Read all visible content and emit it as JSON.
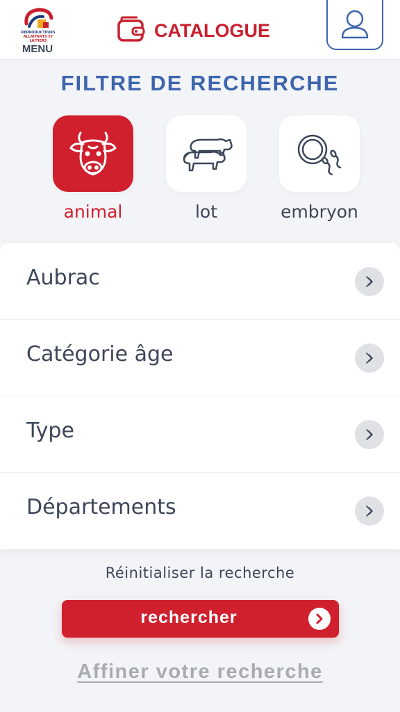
{
  "header": {
    "logo_text_line1": "REPRODUCTEURS",
    "logo_text_line2": "ALLAITANTS ET LAITIERS",
    "menu_label": "MENU",
    "title": "CATALOGUE",
    "title_icon": "wallet-icon",
    "account_icon": "user-icon"
  },
  "filter_title": "FILTRE DE RECHERCHE",
  "categories": [
    {
      "label": "animal",
      "icon": "cow-head-icon",
      "active": true
    },
    {
      "label": "lot",
      "icon": "herd-icon",
      "active": false
    },
    {
      "label": "embryon",
      "icon": "embryo-icon",
      "active": false
    }
  ],
  "filters": [
    {
      "label": "Aubrac"
    },
    {
      "label": "Catégorie âge"
    },
    {
      "label": "Type"
    },
    {
      "label": "Départements"
    }
  ],
  "reset_label": "Réinitialiser la recherche",
  "search_label": "rechercher",
  "refine_label": "Affiner votre recherche",
  "colors": {
    "accent_red": "#d0202d",
    "accent_blue": "#3d64ad",
    "text": "#3d4659",
    "background": "#f3f4f7"
  }
}
